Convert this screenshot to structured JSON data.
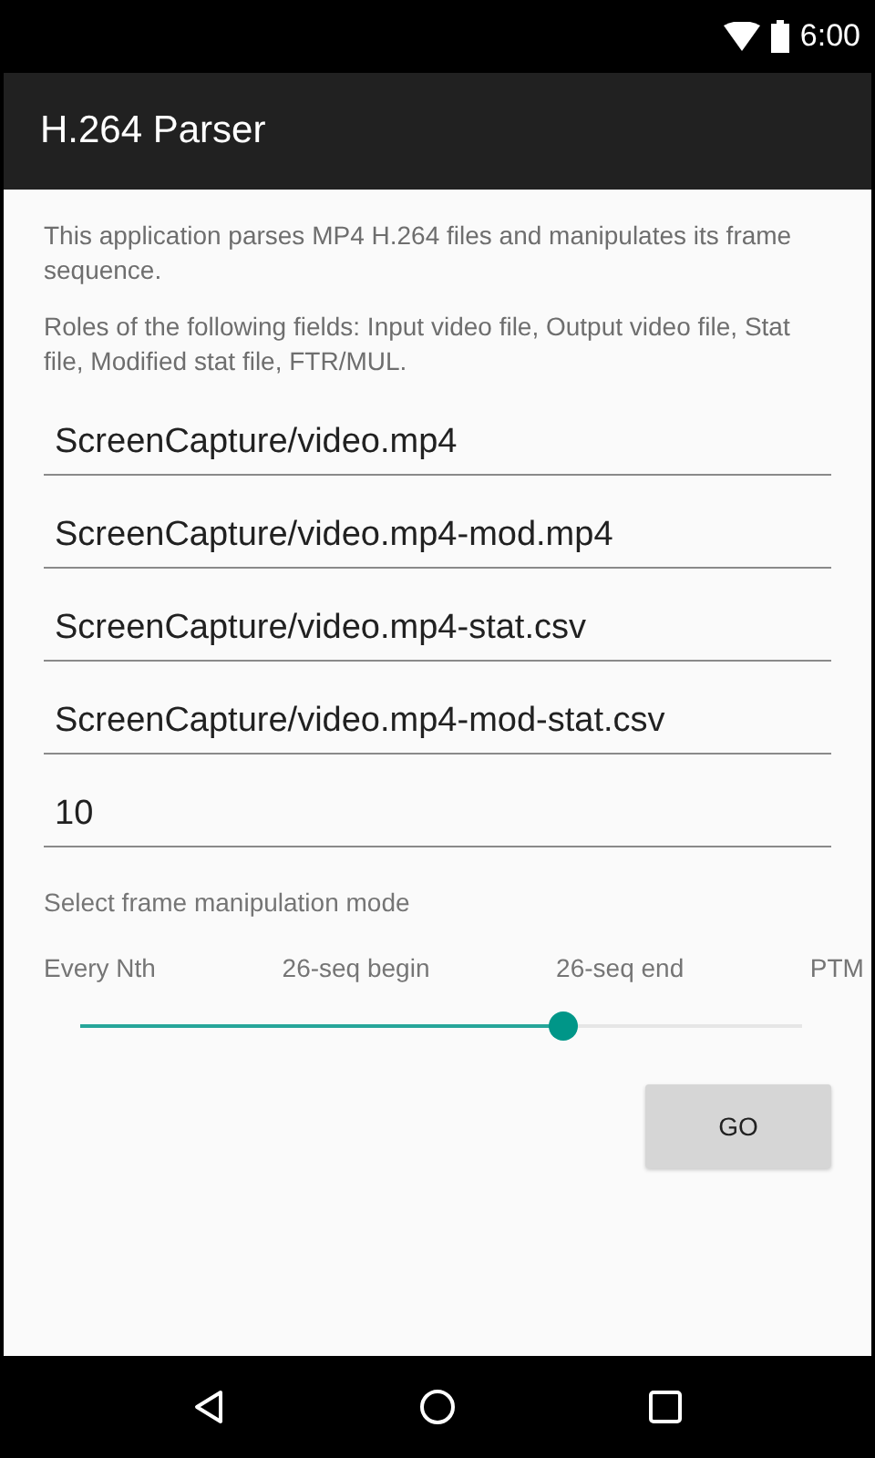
{
  "status_bar": {
    "time": "6:00"
  },
  "app_bar": {
    "title": "H.264 Parser"
  },
  "description": "This application parses MP4 H.264 files and manipulates its frame sequence.",
  "fields_hint": "Roles of the following fields: Input video file, Output video file, Stat file, Modified stat file, FTR/MUL.",
  "fields": [
    {
      "value": "ScreenCapture/video.mp4"
    },
    {
      "value": "ScreenCapture/video.mp4-mod.mp4"
    },
    {
      "value": "ScreenCapture/video.mp4-stat.csv"
    },
    {
      "value": "ScreenCapture/video.mp4-mod-stat.csv"
    },
    {
      "value": "10"
    }
  ],
  "mode": {
    "label": "Select frame manipulation mode",
    "options": [
      "Every Nth",
      "26-seq begin",
      "26-seq end",
      "PTM"
    ],
    "level": 0.67
  },
  "go_button": "GO"
}
